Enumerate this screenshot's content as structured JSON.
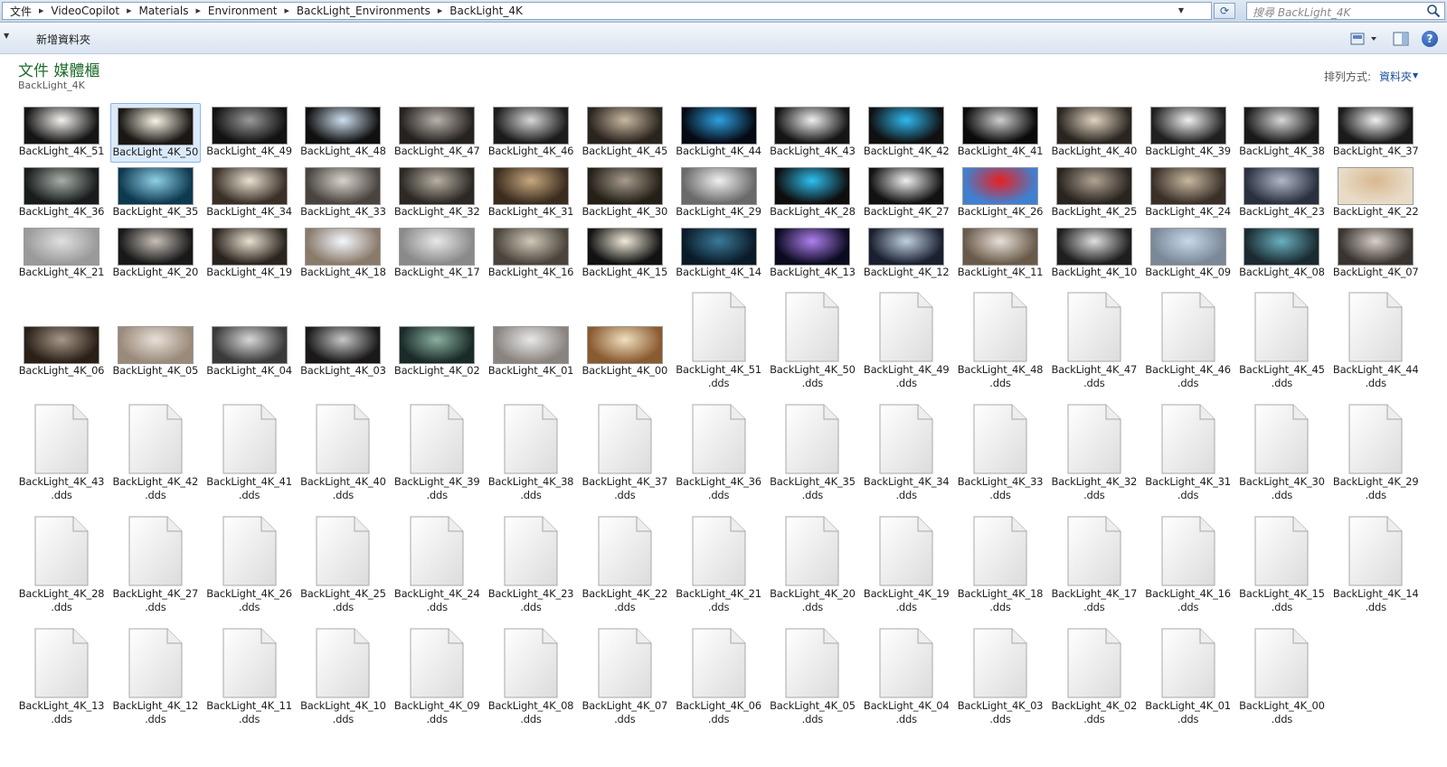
{
  "breadcrumbs": [
    "文件",
    "VideoCopilot",
    "Materials",
    "Environment",
    "BackLight_Environments",
    "BackLight_4K"
  ],
  "search": {
    "placeholder": "搜尋 BackLight_4K"
  },
  "toolbar": {
    "new_folder": "新增資料夾",
    "help": "?"
  },
  "library": {
    "title": "文件 媒體櫃",
    "subtitle": "BackLight_4K"
  },
  "arrange": {
    "label": "排列方式:",
    "value": "資料夾"
  },
  "colors": {
    "title_green": "#1e6b2a",
    "link_blue": "#1e4fa0",
    "selection": "#dbeafb"
  },
  "image_items": [
    {
      "name": "BackLight_4K_51",
      "colors": [
        "#f4f2ee",
        "#151515"
      ]
    },
    {
      "name": "BackLight_4K_50",
      "colors": [
        "#f8f4e6",
        "#1a1714"
      ],
      "selected": true
    },
    {
      "name": "BackLight_4K_49",
      "colors": [
        "#9a9a9a",
        "#121212"
      ]
    },
    {
      "name": "BackLight_4K_48",
      "colors": [
        "#cfe0f0",
        "#101010"
      ]
    },
    {
      "name": "BackLight_4K_47",
      "colors": [
        "#b8b2aa",
        "#262220"
      ]
    },
    {
      "name": "BackLight_4K_46",
      "colors": [
        "#d8d8d8",
        "#1c1c1c"
      ]
    },
    {
      "name": "BackLight_4K_45",
      "colors": [
        "#c8b8a0",
        "#2a241e"
      ]
    },
    {
      "name": "BackLight_4K_44",
      "colors": [
        "#2fa0e0",
        "#050a14"
      ]
    },
    {
      "name": "BackLight_4K_43",
      "colors": [
        "#f0f0f0",
        "#151515"
      ]
    },
    {
      "name": "BackLight_4K_42",
      "colors": [
        "#30b8f0",
        "#101010"
      ]
    },
    {
      "name": "BackLight_4K_41",
      "colors": [
        "#d0d0d0",
        "#0a0a0a"
      ]
    },
    {
      "name": "BackLight_4K_40",
      "colors": [
        "#e0d4c0",
        "#2a2520"
      ]
    },
    {
      "name": "BackLight_4K_39",
      "colors": [
        "#f0f0f0",
        "#202020"
      ]
    },
    {
      "name": "BackLight_4K_38",
      "colors": [
        "#d8d8d8",
        "#1a1a1a"
      ]
    },
    {
      "name": "BackLight_4K_37",
      "colors": [
        "#f0f0f0",
        "#1a1a1a"
      ]
    },
    {
      "name": "BackLight_4K_36",
      "colors": [
        "#a8b0a8",
        "#181c1c"
      ]
    },
    {
      "name": "BackLight_4K_35",
      "colors": [
        "#8fd0e8",
        "#0e3a50"
      ]
    },
    {
      "name": "BackLight_4K_34",
      "colors": [
        "#e8e0d0",
        "#3a3028"
      ]
    },
    {
      "name": "BackLight_4K_33",
      "colors": [
        "#d8d4cc",
        "#4a4440"
      ]
    },
    {
      "name": "BackLight_4K_32",
      "colors": [
        "#b8b0a4",
        "#2c2824"
      ]
    },
    {
      "name": "BackLight_4K_31",
      "colors": [
        "#c8a880",
        "#3a2c1e"
      ]
    },
    {
      "name": "BackLight_4K_30",
      "colors": [
        "#a89c8c",
        "#242018"
      ]
    },
    {
      "name": "BackLight_4K_29",
      "colors": [
        "#f0f0f0",
        "#6a6a6a"
      ]
    },
    {
      "name": "BackLight_4K_28",
      "colors": [
        "#30c0f0",
        "#0e0e0e"
      ]
    },
    {
      "name": "BackLight_4K_27",
      "colors": [
        "#f0f0f0",
        "#121212"
      ]
    },
    {
      "name": "BackLight_4K_26",
      "colors": [
        "#e82020",
        "#4080d0"
      ]
    },
    {
      "name": "BackLight_4K_25",
      "colors": [
        "#b0a494",
        "#2a2420"
      ]
    },
    {
      "name": "BackLight_4K_24",
      "colors": [
        "#c8b8a0",
        "#3a3028"
      ]
    },
    {
      "name": "BackLight_4K_23",
      "colors": [
        "#b0b8c8",
        "#2a3040"
      ]
    },
    {
      "name": "BackLight_4K_22",
      "colors": [
        "#d8b890",
        "#e8dcc8"
      ]
    },
    {
      "name": "BackLight_4K_21",
      "colors": [
        "#e0e0e0",
        "#9a9a9a"
      ]
    },
    {
      "name": "BackLight_4K_20",
      "colors": [
        "#c8c0b8",
        "#181818"
      ]
    },
    {
      "name": "BackLight_4K_19",
      "colors": [
        "#e8e0d0",
        "#2a241e"
      ]
    },
    {
      "name": "BackLight_4K_18",
      "colors": [
        "#f4f8ff",
        "#8a7a6a"
      ]
    },
    {
      "name": "BackLight_4K_17",
      "colors": [
        "#e8e8e8",
        "#8a8a8a"
      ]
    },
    {
      "name": "BackLight_4K_16",
      "colors": [
        "#d0c8b8",
        "#4a443c"
      ]
    },
    {
      "name": "BackLight_4K_15",
      "colors": [
        "#f0ead8",
        "#121212"
      ]
    },
    {
      "name": "BackLight_4K_14",
      "colors": [
        "#3a7a9a",
        "#0a1a28"
      ]
    },
    {
      "name": "BackLight_4K_13",
      "colors": [
        "#b080f0",
        "#0a0a20"
      ]
    },
    {
      "name": "BackLight_4K_12",
      "colors": [
        "#c0d0e0",
        "#1a2030"
      ]
    },
    {
      "name": "BackLight_4K_11",
      "colors": [
        "#e8e0d8",
        "#6a5a4a"
      ]
    },
    {
      "name": "BackLight_4K_10",
      "colors": [
        "#e0e0e0",
        "#1e1e1e"
      ]
    },
    {
      "name": "BackLight_4K_09",
      "colors": [
        "#c8d8e8",
        "#7a8898"
      ]
    },
    {
      "name": "BackLight_4K_08",
      "colors": [
        "#6ab0c0",
        "#1a2a30"
      ]
    },
    {
      "name": "BackLight_4K_07",
      "colors": [
        "#d8d0c8",
        "#3a3430"
      ]
    },
    {
      "name": "BackLight_4K_06",
      "colors": [
        "#a89888",
        "#2a2018"
      ]
    },
    {
      "name": "BackLight_4K_05",
      "colors": [
        "#e8e0d8",
        "#9a8a7a"
      ]
    },
    {
      "name": "BackLight_4K_04",
      "colors": [
        "#d8d8d8",
        "#3a3a3a"
      ]
    },
    {
      "name": "BackLight_4K_03",
      "colors": [
        "#c8c8c8",
        "#1a1818"
      ]
    },
    {
      "name": "BackLight_4K_02",
      "colors": [
        "#8ab0a0",
        "#1a2a28"
      ]
    },
    {
      "name": "BackLight_4K_01",
      "colors": [
        "#e8e8e8",
        "#8a8480"
      ]
    },
    {
      "name": "BackLight_4K_00",
      "colors": [
        "#f0e0c0",
        "#8a5a30"
      ]
    }
  ],
  "dds_items": [
    {
      "name": "BackLight_4K_51",
      "ext": ".dds"
    },
    {
      "name": "BackLight_4K_50",
      "ext": ".dds"
    },
    {
      "name": "BackLight_4K_49",
      "ext": ".dds"
    },
    {
      "name": "BackLight_4K_48",
      "ext": ".dds"
    },
    {
      "name": "BackLight_4K_47",
      "ext": ".dds"
    },
    {
      "name": "BackLight_4K_46",
      "ext": ".dds"
    },
    {
      "name": "BackLight_4K_45",
      "ext": ".dds"
    },
    {
      "name": "BackLight_4K_44",
      "ext": ".dds"
    },
    {
      "name": "BackLight_4K_43",
      "ext": ".dds"
    },
    {
      "name": "BackLight_4K_42",
      "ext": ".dds"
    },
    {
      "name": "BackLight_4K_41",
      "ext": ".dds"
    },
    {
      "name": "BackLight_4K_40",
      "ext": ".dds"
    },
    {
      "name": "BackLight_4K_39",
      "ext": ".dds"
    },
    {
      "name": "BackLight_4K_38",
      "ext": ".dds"
    },
    {
      "name": "BackLight_4K_37",
      "ext": ".dds"
    },
    {
      "name": "BackLight_4K_36",
      "ext": ".dds"
    },
    {
      "name": "BackLight_4K_35",
      "ext": ".dds"
    },
    {
      "name": "BackLight_4K_34",
      "ext": ".dds"
    },
    {
      "name": "BackLight_4K_33",
      "ext": ".dds"
    },
    {
      "name": "BackLight_4K_32",
      "ext": ".dds"
    },
    {
      "name": "BackLight_4K_31",
      "ext": ".dds"
    },
    {
      "name": "BackLight_4K_30",
      "ext": ".dds"
    },
    {
      "name": "BackLight_4K_29",
      "ext": ".dds"
    },
    {
      "name": "BackLight_4K_28",
      "ext": ".dds"
    },
    {
      "name": "BackLight_4K_27",
      "ext": ".dds"
    },
    {
      "name": "BackLight_4K_26",
      "ext": ".dds"
    },
    {
      "name": "BackLight_4K_25",
      "ext": ".dds"
    },
    {
      "name": "BackLight_4K_24",
      "ext": ".dds"
    },
    {
      "name": "BackLight_4K_23",
      "ext": ".dds"
    },
    {
      "name": "BackLight_4K_22",
      "ext": ".dds"
    },
    {
      "name": "BackLight_4K_21",
      "ext": ".dds"
    },
    {
      "name": "BackLight_4K_20",
      "ext": ".dds"
    },
    {
      "name": "BackLight_4K_19",
      "ext": ".dds"
    },
    {
      "name": "BackLight_4K_18",
      "ext": ".dds"
    },
    {
      "name": "BackLight_4K_17",
      "ext": ".dds"
    },
    {
      "name": "BackLight_4K_16",
      "ext": ".dds"
    },
    {
      "name": "BackLight_4K_15",
      "ext": ".dds"
    },
    {
      "name": "BackLight_4K_14",
      "ext": ".dds"
    },
    {
      "name": "BackLight_4K_13",
      "ext": ".dds"
    },
    {
      "name": "BackLight_4K_12",
      "ext": ".dds"
    },
    {
      "name": "BackLight_4K_11",
      "ext": ".dds"
    },
    {
      "name": "BackLight_4K_10",
      "ext": ".dds"
    },
    {
      "name": "BackLight_4K_09",
      "ext": ".dds"
    },
    {
      "name": "BackLight_4K_08",
      "ext": ".dds"
    },
    {
      "name": "BackLight_4K_07",
      "ext": ".dds"
    },
    {
      "name": "BackLight_4K_06",
      "ext": ".dds"
    },
    {
      "name": "BackLight_4K_05",
      "ext": ".dds"
    },
    {
      "name": "BackLight_4K_04",
      "ext": ".dds"
    },
    {
      "name": "BackLight_4K_03",
      "ext": ".dds"
    },
    {
      "name": "BackLight_4K_02",
      "ext": ".dds"
    },
    {
      "name": "BackLight_4K_01",
      "ext": ".dds"
    },
    {
      "name": "BackLight_4K_00",
      "ext": ".dds"
    }
  ]
}
